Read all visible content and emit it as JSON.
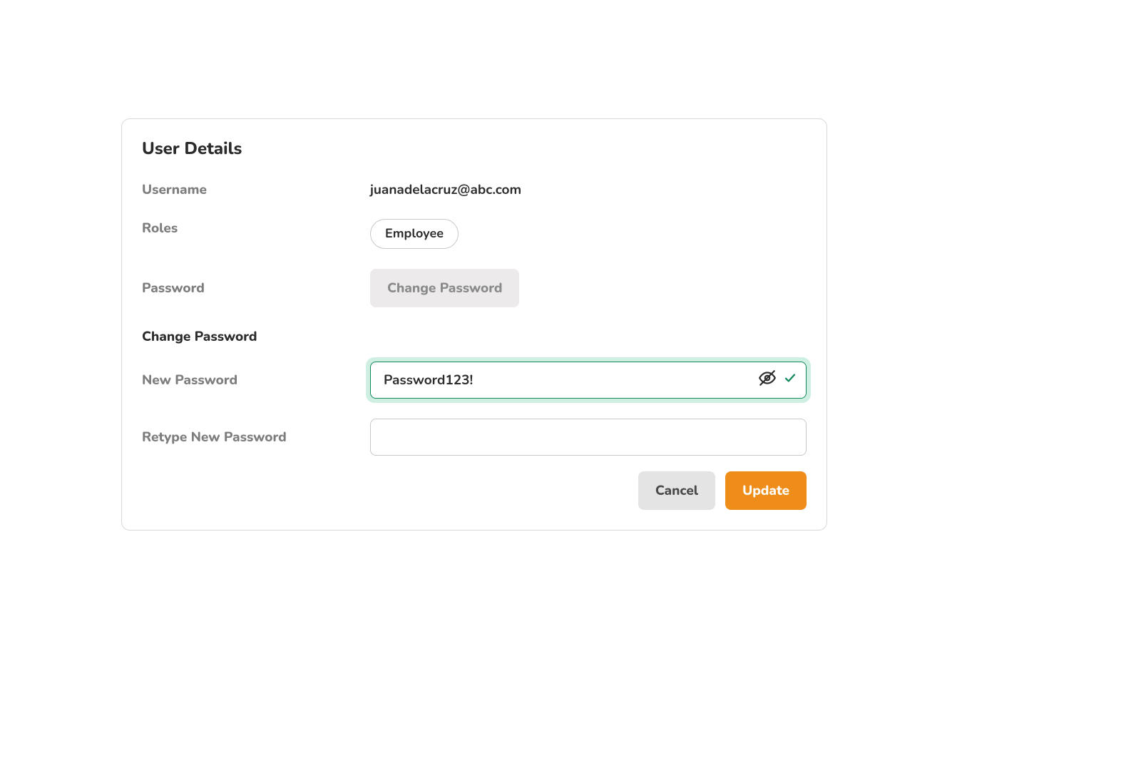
{
  "card": {
    "title": "User Details",
    "labels": {
      "username": "Username",
      "roles": "Roles",
      "password": "Password",
      "changePasswordHeading": "Change Password",
      "newPassword": "New Password",
      "retypeNewPassword": "Retype New Password"
    },
    "values": {
      "username": "juanadelacruz@abc.com",
      "role": "Employee",
      "newPassword": "Password123!",
      "retypeNewPassword": ""
    },
    "buttons": {
      "changePassword": "Change Password",
      "cancel": "Cancel",
      "update": "Update"
    }
  },
  "colors": {
    "accentGreen": "#118a5a",
    "focusRing": "#a7e1cc",
    "orange": "#ef8d1a"
  }
}
